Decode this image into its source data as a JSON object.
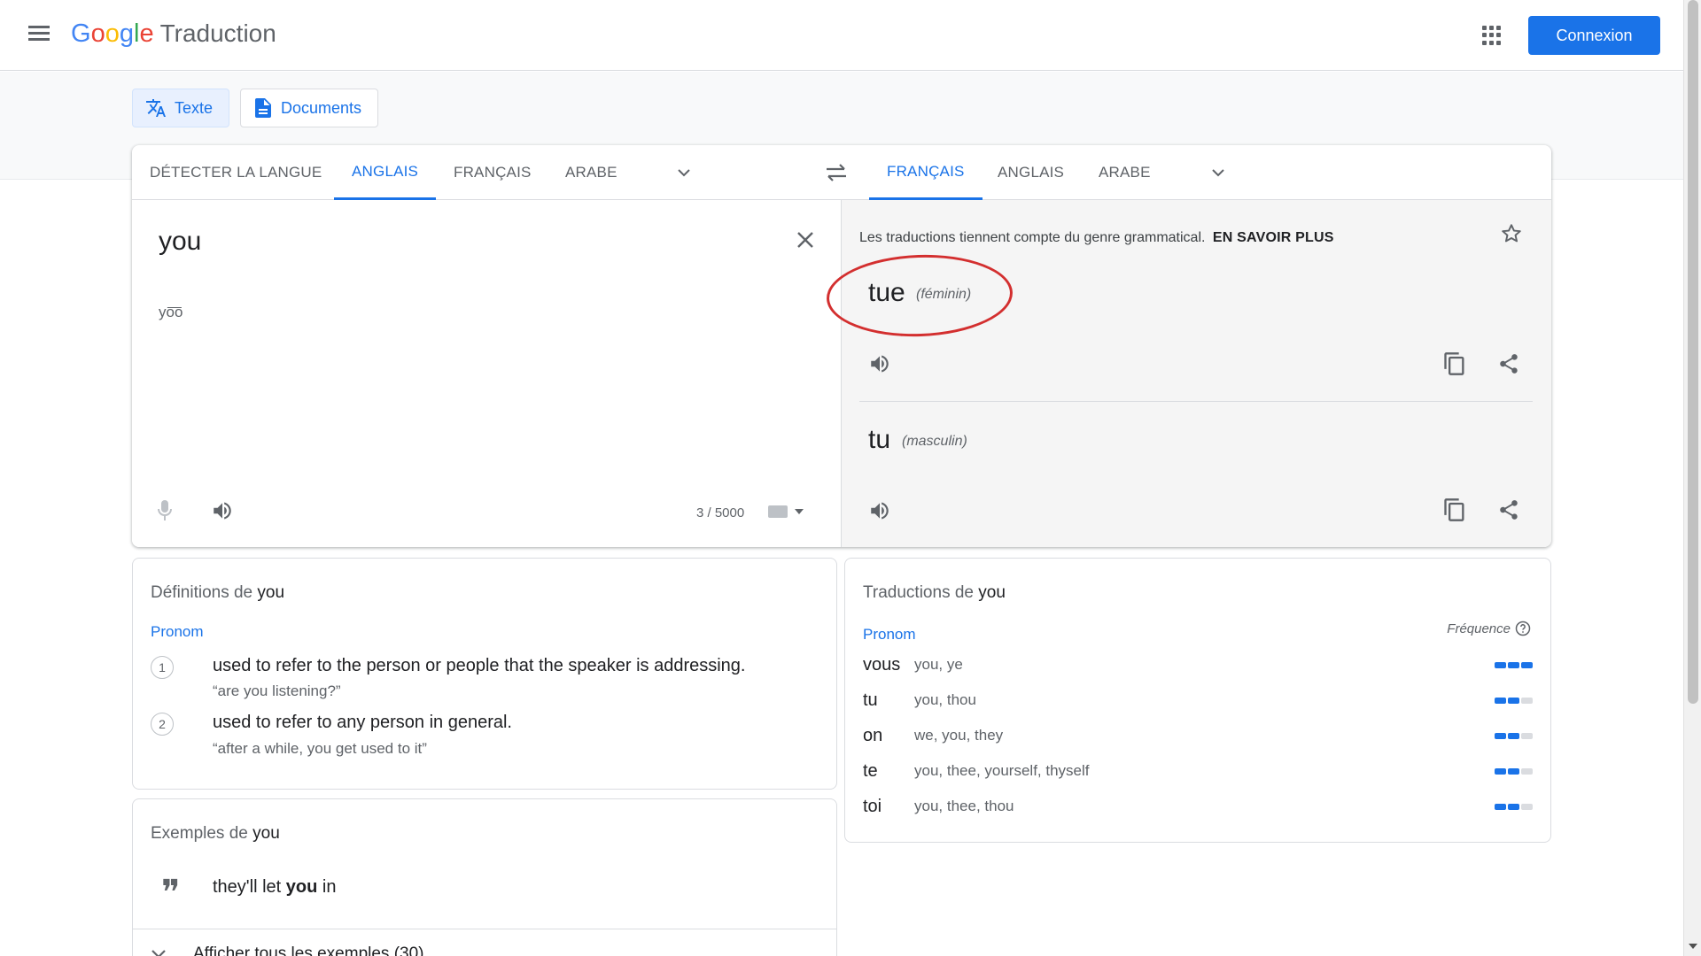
{
  "header": {
    "logo_letters": [
      "G",
      "o",
      "o",
      "g",
      "l",
      "e"
    ],
    "product": "Traduction",
    "signin_label": "Connexion"
  },
  "modes": {
    "text_label": "Texte",
    "documents_label": "Documents"
  },
  "source_langs": {
    "detect": "DÉTECTER LA LANGUE",
    "english": "ANGLAIS",
    "french": "FRANÇAIS",
    "arabic": "ARABE"
  },
  "target_langs": {
    "french": "FRANÇAIS",
    "english": "ANGLAIS",
    "arabic": "ARABE"
  },
  "source": {
    "text": "you",
    "phonetic": "yo͞o",
    "char_count": "3 / 5000"
  },
  "target": {
    "gender_note": "Les traductions tiennent compte du genre grammatical.",
    "learn_more": "EN SAVOIR PLUS",
    "feminine": {
      "word": "tue",
      "gender": "(féminin)"
    },
    "masculine": {
      "word": "tu",
      "gender": "(masculin)"
    }
  },
  "definitions": {
    "title_prefix": "Définitions de",
    "title_word": "you",
    "pos": "Pronom",
    "items": [
      {
        "num": "1",
        "text": "used to refer to the person or people that the speaker is addressing.",
        "example": "“are you listening?”"
      },
      {
        "num": "2",
        "text": "used to refer to any person in general.",
        "example": "“after a while, you get used to it”"
      }
    ]
  },
  "translations": {
    "title_prefix": "Traductions de",
    "title_word": "you",
    "pos": "Pronom",
    "frequency_label": "Fréquence",
    "rows": [
      {
        "word": "vous",
        "back": "you, ye",
        "frequency": 3
      },
      {
        "word": "tu",
        "back": "you, thou",
        "frequency": 2
      },
      {
        "word": "on",
        "back": "we, you, they",
        "frequency": 2
      },
      {
        "word": "te",
        "back": "you, thee, yourself, thyself",
        "frequency": 2
      },
      {
        "word": "toi",
        "back": "you, thee, thou",
        "frequency": 2
      }
    ]
  },
  "examples": {
    "title_prefix": "Exemples de",
    "title_word": "you",
    "example_before": "they'll let ",
    "example_bold": "you",
    "example_after": " in",
    "show_all": "Afficher tous les exemples (30)"
  },
  "colors": {
    "accent": "#1a73e8",
    "annotation": "#d32f2f"
  }
}
